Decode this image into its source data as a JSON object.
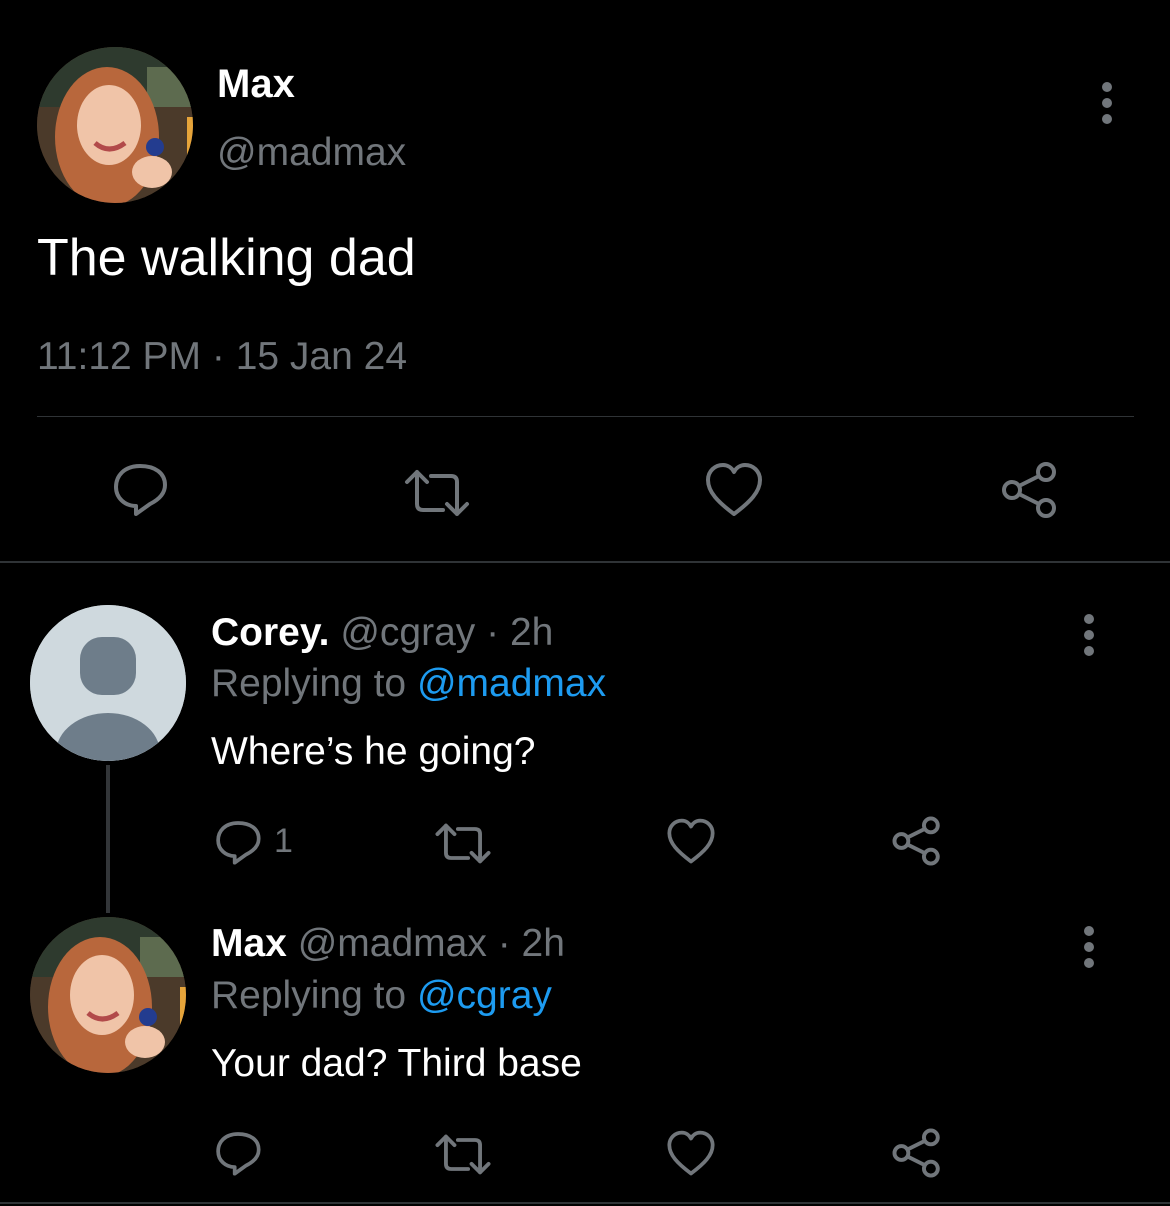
{
  "main_tweet": {
    "author_name": "Max",
    "handle": "@madmax",
    "text": "The walking dad",
    "timestamp": "11:12 PM · 15 Jan 24",
    "actions": [
      "reply-icon",
      "retweet-icon",
      "like-icon",
      "share-icon"
    ]
  },
  "replies": [
    {
      "author_name": "Corey.",
      "handle": "@cgray",
      "time": "· 2h",
      "replying_prefix": "Replying to",
      "replying_to": "@madmax",
      "text": "Where’s he going?",
      "reply_count": "1"
    },
    {
      "author_name": "Max",
      "handle": "@madmax",
      "time": "· 2h",
      "replying_prefix": "Replying to",
      "replying_to": "@cgray",
      "text": "Your dad? Third base",
      "reply_count": ""
    }
  ],
  "colors": {
    "background": "#000000",
    "muted": "#71767b",
    "link": "#1d9bf0",
    "text": "#e7e9ea"
  }
}
